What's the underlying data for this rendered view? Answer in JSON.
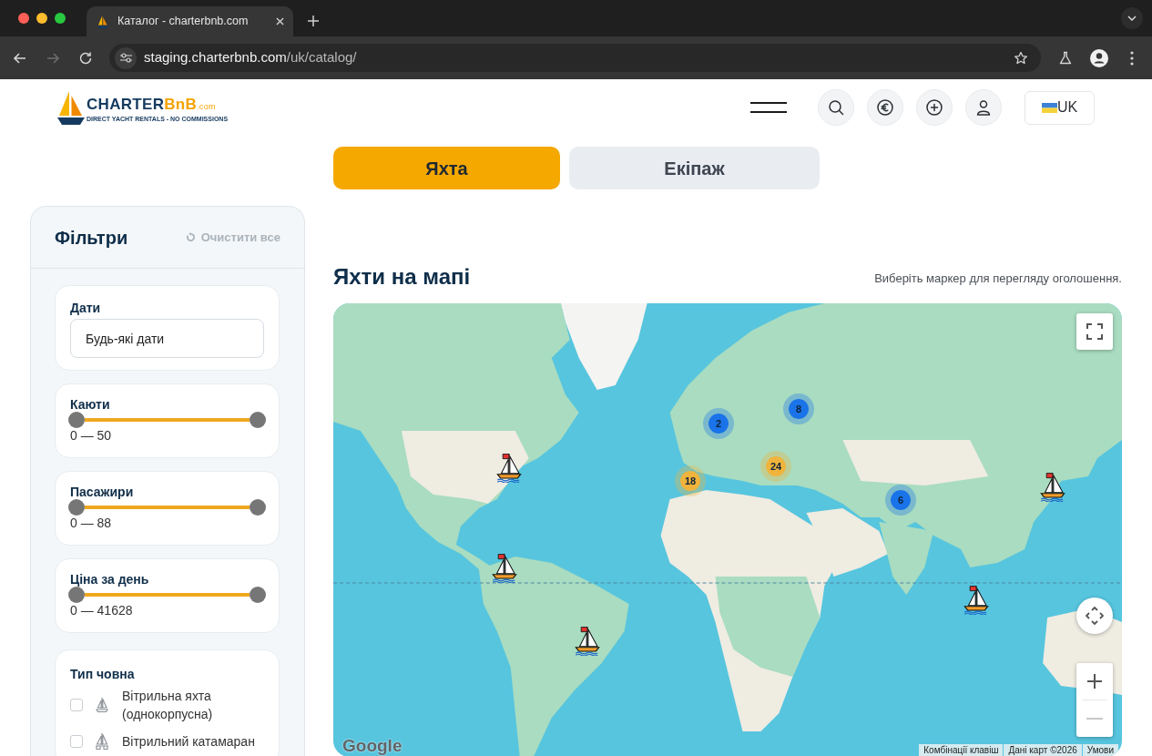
{
  "browser": {
    "tab_title": "Каталог - charterbnb.com",
    "url_host": "staging.charterbnb.com",
    "url_path": "/uk/catalog/",
    "forward_disabled": true
  },
  "header": {
    "logo": {
      "name": "CHARTER",
      "accent": "BnB",
      "domain": ".com",
      "tagline": "DIRECT YACHT RENTALS - NO COMMISSIONS"
    },
    "language": "UK"
  },
  "tabs": [
    {
      "label": "Яхта",
      "selected": true
    },
    {
      "label": "Екіпаж",
      "selected": false
    }
  ],
  "filters": {
    "title": "Фільтри",
    "clear_all": {
      "label": "Очистити все",
      "disabled": true
    },
    "dates": {
      "label": "Дати",
      "value": "Будь-які дати"
    },
    "ranges": [
      {
        "label": "Каюти",
        "level": 1,
        "reading": "0 — 50"
      },
      {
        "label": "Пасажири",
        "level": 1,
        "reading": "0 — 88"
      },
      {
        "label": "Ціна за день",
        "level": 1,
        "reading": "0 — 41628"
      }
    ],
    "boat_type": {
      "label": "Тип човна",
      "options": [
        {
          "kind": "monohull",
          "label": "Вітрильна яхта (однокорпусна)",
          "checked": false
        },
        {
          "kind": "catamaran",
          "label": "Вітрильний катамаран",
          "checked": false
        }
      ]
    }
  },
  "map_section": {
    "title": "Яхти на мапі",
    "hint": "Виберіть маркер для перегляду оголошення.",
    "markers": [
      {
        "kind": "cluster",
        "count": "8",
        "color": "#1a73e8"
      },
      {
        "kind": "cluster",
        "count": "2",
        "color": "#1a73e8"
      },
      {
        "kind": "boat"
      },
      {
        "kind": "cluster",
        "count": "24",
        "color": "#f0b43c"
      },
      {
        "kind": "cluster",
        "count": "18",
        "color": "#f0b43c"
      },
      {
        "kind": "boat"
      },
      {
        "kind": "cluster",
        "count": "6",
        "color": "#1a73e8"
      },
      {
        "kind": "boat"
      },
      {
        "kind": "boat"
      },
      {
        "kind": "boat"
      }
    ],
    "zoom_out_disabled": true,
    "logo": "Google",
    "attribution": [
      "Комбінації клавіш",
      "Дані карт ©2026",
      "Умови"
    ]
  }
}
